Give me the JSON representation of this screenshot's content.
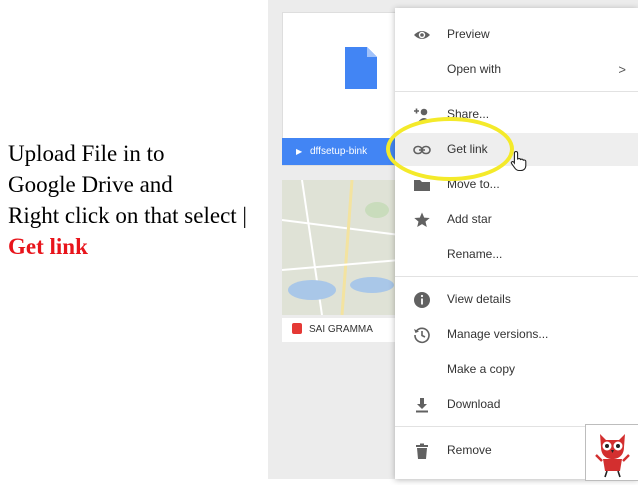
{
  "instructions": {
    "line1": "Upload File in to",
    "line2": "Google Drive and",
    "line3": "Right click on that select |",
    "line4": "Get link"
  },
  "drive": {
    "file_name": "dffsetup-bink",
    "map_caption": "SAI GRAMMA"
  },
  "menu": {
    "items": [
      {
        "label": "Preview",
        "icon": "eye-icon"
      },
      {
        "label": "Open with",
        "icon": "",
        "submenu": ">"
      },
      {
        "label": "Share...",
        "icon": "add-person-icon"
      },
      {
        "label": "Get link",
        "icon": "link-icon"
      },
      {
        "label": "Move to...",
        "icon": "folder-icon"
      },
      {
        "label": "Add star",
        "icon": "star-icon"
      },
      {
        "label": "Rename...",
        "icon": ""
      },
      {
        "label": "View details",
        "icon": "info-icon"
      },
      {
        "label": "Manage versions...",
        "icon": "history-icon"
      },
      {
        "label": "Make a copy",
        "icon": ""
      },
      {
        "label": "Download",
        "icon": "download-icon"
      },
      {
        "label": "Remove",
        "icon": "trash-icon"
      }
    ]
  },
  "colors": {
    "highlight_ring": "#f4ea2a",
    "instruction_accent": "#e8141b",
    "drive_blue": "#4285f4"
  }
}
